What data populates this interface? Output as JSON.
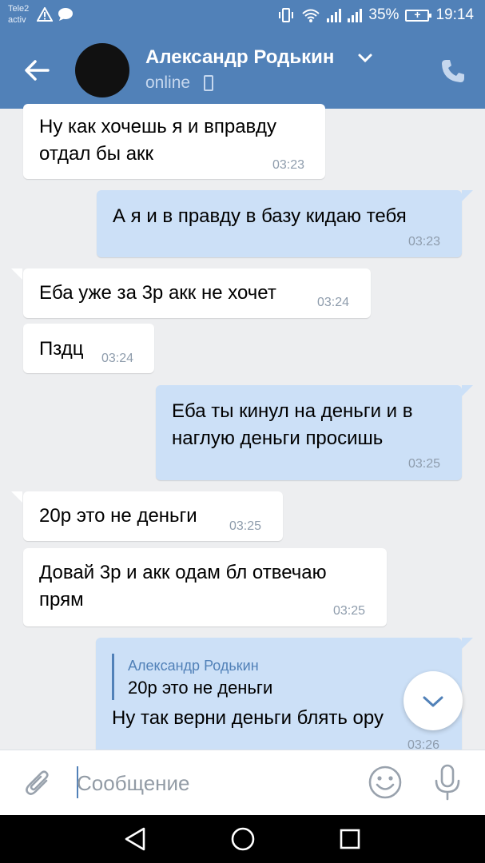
{
  "status_bar": {
    "carrier_line1": "Tele2",
    "carrier_line2": "activ",
    "battery": "35%",
    "time": "19:14"
  },
  "header": {
    "contact_name": "Александр Родькин",
    "status": "online"
  },
  "messages": [
    {
      "direction": "in",
      "lines": [
        "Ну как хочешь я и вправду",
        "отдал бы акк"
      ],
      "time": "03:23"
    },
    {
      "direction": "out",
      "lines": [
        "А я и в правду в базу кидаю тебя"
      ],
      "time": "03:23"
    },
    {
      "direction": "in",
      "lines": [
        "Еба уже за 3р акк не хочет"
      ],
      "time": "03:24"
    },
    {
      "direction": "in",
      "lines": [
        "Пздц"
      ],
      "time": "03:24"
    },
    {
      "direction": "out",
      "lines": [
        "Еба ты кинул на деньги и в",
        "наглую деньги просишь"
      ],
      "time": "03:25"
    },
    {
      "direction": "in",
      "lines": [
        "20р это не деньги"
      ],
      "time": "03:25"
    },
    {
      "direction": "in",
      "lines": [
        "Довай 3р и акк одам бл отвечаю",
        "прям"
      ],
      "time": "03:25"
    },
    {
      "direction": "out",
      "quote": {
        "author": "Александр Родькин",
        "text": "20р это не деньги"
      },
      "lines": [
        "Ну так верни деньги блять ору"
      ],
      "time": "03:26"
    }
  ],
  "composer": {
    "placeholder": "Сообщение"
  },
  "colors": {
    "header": "#5181b8",
    "outgoing_bubble": "#cce0f7",
    "incoming_bubble": "#ffffff",
    "background": "#edeef0"
  },
  "icons": [
    "alert-icon",
    "chat-icon",
    "vibrate-icon",
    "wifi-icon",
    "signal-icon",
    "battery-icon",
    "back-arrow-icon",
    "chevron-down-icon",
    "mobile-icon",
    "phone-icon",
    "paperclip-icon",
    "emoji-icon",
    "microphone-icon",
    "nav-back-icon",
    "nav-home-icon",
    "nav-recents-icon"
  ]
}
